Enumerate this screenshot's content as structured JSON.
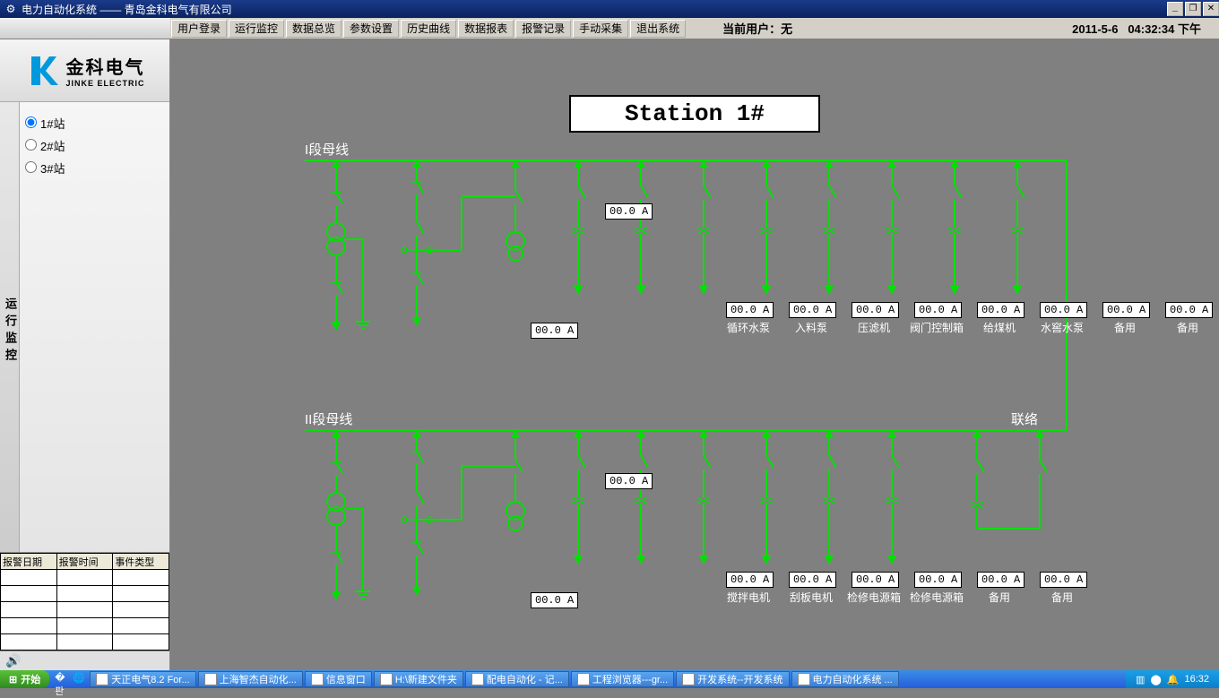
{
  "titlebar": {
    "text": "电力自动化系统 —— 青岛金科电气有限公司"
  },
  "menu": {
    "items": [
      "用户登录",
      "运行监控",
      "数据总览",
      "参数设置",
      "历史曲线",
      "数据报表",
      "报警记录",
      "手动采集",
      "退出系统"
    ]
  },
  "user": {
    "label": "当前用户：",
    "value": "无"
  },
  "datetime": {
    "date": "2011-5-6",
    "time": "04:32:34",
    "ampm": "下午"
  },
  "logo": {
    "cn": "金科电气",
    "en": "JINKE ELECTRIC"
  },
  "nav": {
    "label": "运行监控",
    "items": [
      "1#站",
      "2#站",
      "3#站"
    ],
    "selected": 0
  },
  "alarm": {
    "headers": [
      "报警日期",
      "报警时间",
      "事件类型"
    ],
    "rows": 5
  },
  "station": {
    "title": "Station 1#"
  },
  "bus1": {
    "label": "I段母线",
    "inc_val": "00.0 A",
    "out_val": "00.0 A",
    "feeders": [
      {
        "label": "循环水泵",
        "val": "00.0 A"
      },
      {
        "label": "入料泵",
        "val": "00.0 A"
      },
      {
        "label": "压滤机",
        "val": "00.0 A"
      },
      {
        "label": "阀门控制箱",
        "val": "00.0 A"
      },
      {
        "label": "给煤机",
        "val": "00.0 A"
      },
      {
        "label": "水窖水泵",
        "val": "00.0 A"
      },
      {
        "label": "备用",
        "val": "00.0 A"
      },
      {
        "label": "备用",
        "val": "00.0 A"
      }
    ]
  },
  "bus2": {
    "label": "II段母线",
    "conn": "联络",
    "inc_val": "00.0 A",
    "out_val": "00.0 A",
    "feeders": [
      {
        "label": "搅拌电机",
        "val": "00.0 A"
      },
      {
        "label": "刮板电机",
        "val": "00.0 A"
      },
      {
        "label": "检修电源箱",
        "val": "00.0 A"
      },
      {
        "label": "检修电源箱",
        "val": "00.0 A"
      },
      {
        "label": "备用",
        "val": "00.0 A"
      },
      {
        "label": "备用",
        "val": "00.0 A"
      }
    ]
  },
  "taskbar": {
    "start": "开始",
    "items": [
      "天正电气8.2 For...",
      "上海智杰自动化...",
      "信息窗口",
      "H:\\新建文件夹",
      "配电自动化 - 记...",
      "工程浏览器---gr...",
      "开发系统--开发系统",
      "电力自动化系统 ..."
    ],
    "clock": "16:32"
  }
}
